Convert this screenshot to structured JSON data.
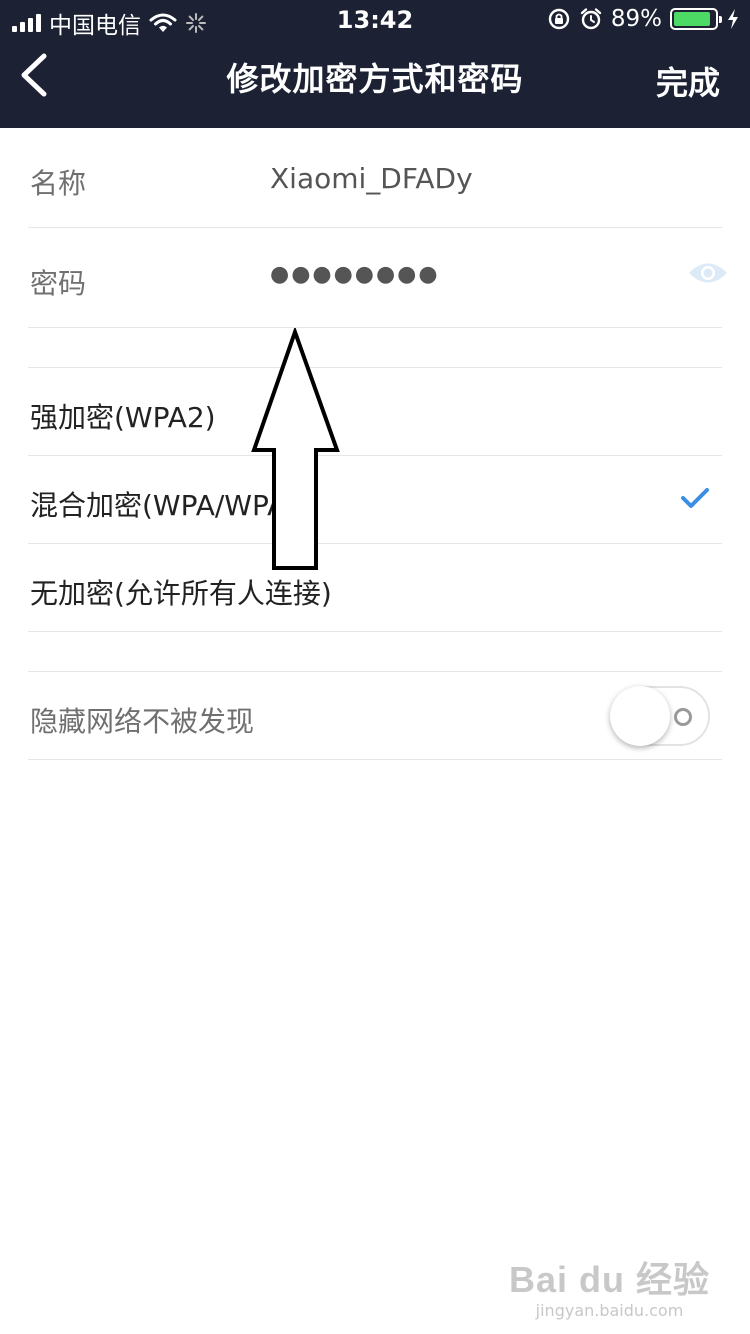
{
  "status_bar": {
    "carrier": "中国电信",
    "time": "13:42",
    "battery_percent": "89%",
    "battery_level": 0.89
  },
  "nav": {
    "title": "修改加密方式和密码",
    "done_label": "完成"
  },
  "fields": {
    "name_label": "名称",
    "name_value": "Xiaomi_DFADy",
    "password_label": "密码",
    "password_value": "●●●●●●●●"
  },
  "encryption_options": [
    {
      "label": "强加密(WPA2)",
      "selected": false
    },
    {
      "label": "混合加密(WPA/WPA2)",
      "selected": true
    },
    {
      "label": "无加密(允许所有人连接)",
      "selected": false
    }
  ],
  "hidden_network": {
    "label": "隐藏网络不被发现",
    "enabled": false
  },
  "watermark": {
    "main": "Bai du 经验",
    "sub": "jingyan.baidu.com"
  },
  "colors": {
    "header_bg": "#1c2233",
    "accent_check": "#3a8ee6",
    "battery_green": "#4cd964"
  }
}
